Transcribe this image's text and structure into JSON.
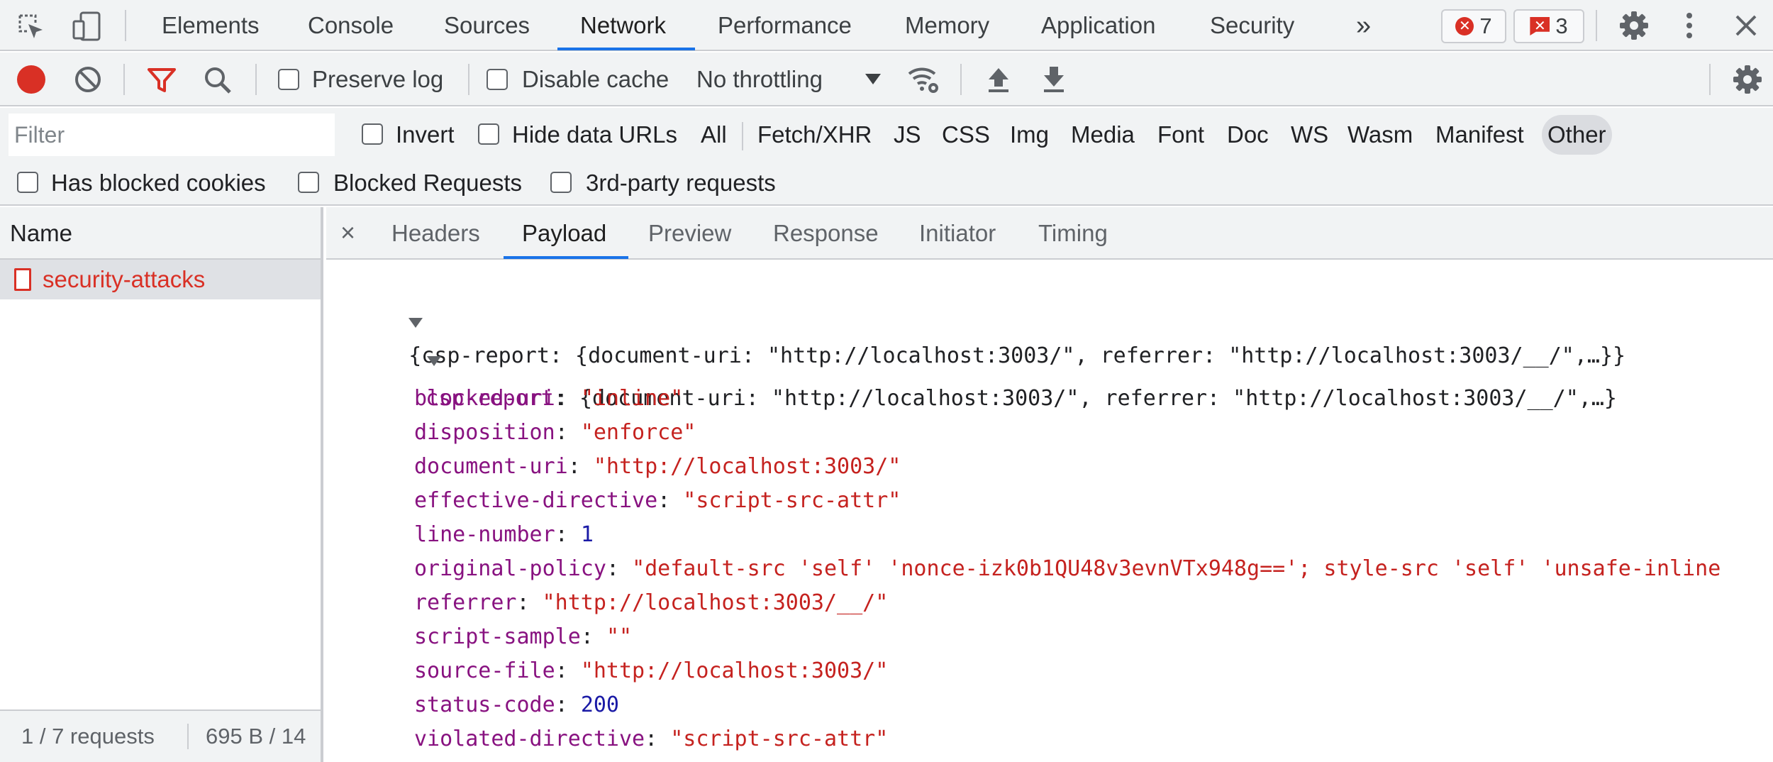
{
  "main_tabs": [
    {
      "label": "Elements"
    },
    {
      "label": "Console"
    },
    {
      "label": "Sources"
    },
    {
      "label": "Network",
      "active": true
    },
    {
      "label": "Performance"
    },
    {
      "label": "Memory"
    },
    {
      "label": "Application"
    },
    {
      "label": "Security"
    }
  ],
  "more_tabs_label": "»",
  "issues": {
    "errors": "7",
    "issues_count": "3"
  },
  "toolbar": {
    "preserve_log": "Preserve log",
    "disable_cache": "Disable cache",
    "throttling": "No throttling"
  },
  "filter": {
    "placeholder": "Filter",
    "invert": "Invert",
    "hide_data_urls": "Hide data URLs",
    "types": [
      "All",
      "Fetch/XHR",
      "JS",
      "CSS",
      "Img",
      "Media",
      "Font",
      "Doc",
      "WS",
      "Wasm",
      "Manifest",
      "Other"
    ],
    "active_type": "Other",
    "has_blocked_cookies": "Has blocked cookies",
    "blocked_requests": "Blocked Requests",
    "third_party": "3rd-party requests"
  },
  "request_list": {
    "header": "Name",
    "requests": [
      {
        "name": "security-attacks"
      }
    ],
    "status_requests": "1 / 7 requests",
    "status_size": "695 B / 14"
  },
  "detail_tabs": [
    {
      "label": "Headers"
    },
    {
      "label": "Payload",
      "active": true
    },
    {
      "label": "Preview"
    },
    {
      "label": "Response"
    },
    {
      "label": "Initiator"
    },
    {
      "label": "Timing"
    }
  ],
  "close_label": "×",
  "payload": {
    "summary": "{csp-report: {document-uri: \"http://localhost:3003/\", referrer: \"http://localhost:3003/__/\",…}}",
    "object_key": "csp-report",
    "object_summary": ": {document-uri: \"http://localhost:3003/\", referrer: \"http://localhost:3003/__/\",…}",
    "fields": [
      {
        "key": "blocked-uri",
        "value": "\"inline\"",
        "type": "string"
      },
      {
        "key": "disposition",
        "value": "\"enforce\"",
        "type": "string"
      },
      {
        "key": "document-uri",
        "value": "\"http://localhost:3003/\"",
        "type": "string"
      },
      {
        "key": "effective-directive",
        "value": "\"script-src-attr\"",
        "type": "string"
      },
      {
        "key": "line-number",
        "value": "1",
        "type": "number"
      },
      {
        "key": "original-policy",
        "value": "\"default-src 'self' 'nonce-izk0b1QU48v3evnVTx948g=='; style-src 'self' 'unsafe-inline",
        "type": "string"
      },
      {
        "key": "referrer",
        "value": "\"http://localhost:3003/__/\"",
        "type": "string"
      },
      {
        "key": "script-sample",
        "value": "\"\"",
        "type": "string"
      },
      {
        "key": "source-file",
        "value": "\"http://localhost:3003/\"",
        "type": "string"
      },
      {
        "key": "status-code",
        "value": "200",
        "type": "number"
      },
      {
        "key": "violated-directive",
        "value": "\"script-src-attr\"",
        "type": "string"
      }
    ]
  },
  "colors": {
    "accent": "#1a73e8",
    "record_red": "#d93025",
    "key_purple": "#881280",
    "string_red": "#c5221f",
    "number_blue": "#1a1aa6"
  },
  "icons": [
    "inspect-element-icon",
    "device-toolbar-icon",
    "record-icon",
    "clear-icon",
    "filter-icon",
    "search-icon",
    "network-conditions-icon",
    "import-har-icon",
    "export-har-icon",
    "settings-icon",
    "kebab-menu-icon",
    "close-devtools-icon",
    "document-icon"
  ]
}
